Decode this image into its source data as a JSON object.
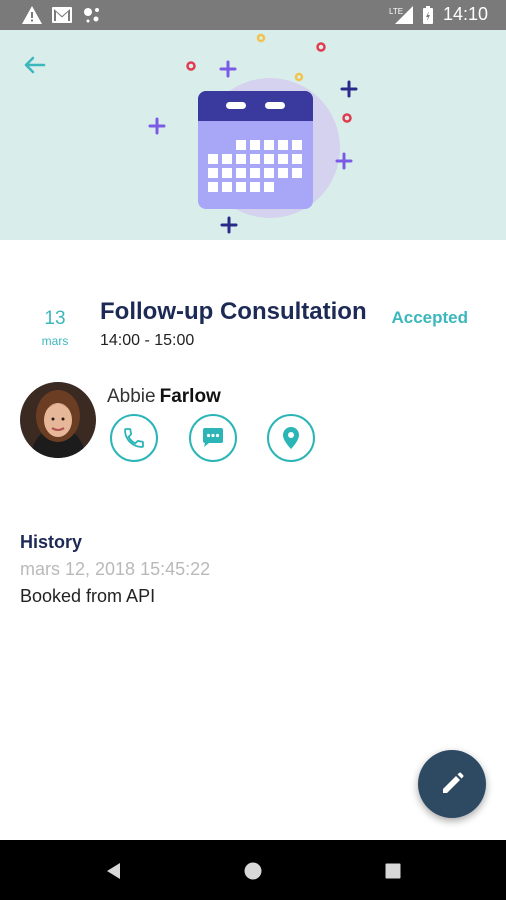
{
  "status_bar": {
    "time": "14:10",
    "network": "LTE",
    "icons": [
      "warning-icon",
      "gmail-icon",
      "assistant-icon",
      "signal-icon",
      "battery-icon"
    ]
  },
  "header": {
    "back_icon": "arrow-left-icon",
    "illustration": "calendar-icon",
    "background_color": "#d9eeea"
  },
  "appointment": {
    "day": "13",
    "month": "mars",
    "title": "Follow-up Consultation",
    "time_range": "14:00 - 15:00",
    "status": "Accepted",
    "accent_color": "#3bb7bd"
  },
  "contact": {
    "first_name": "Abbie",
    "last_name": "Farlow",
    "actions": [
      "phone-icon",
      "chat-icon",
      "location-icon"
    ]
  },
  "history": {
    "heading": "History",
    "date": "mars 12, 2018 15:45:22",
    "text": "Booked from API"
  },
  "fab": {
    "icon": "pencil-icon",
    "color": "#2e4a63"
  },
  "nav_bar": {
    "buttons": [
      "back-triangle-icon",
      "home-circle-icon",
      "recents-square-icon"
    ]
  }
}
